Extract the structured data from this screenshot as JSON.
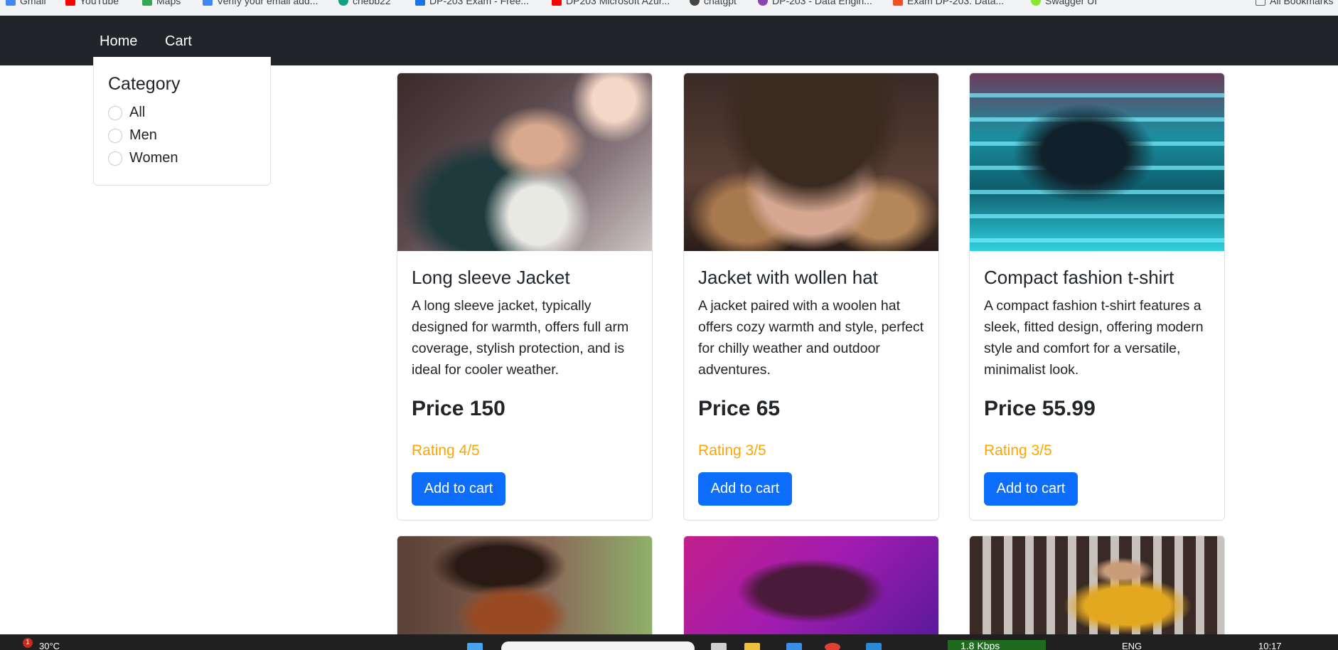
{
  "bookmarks": [
    {
      "label": "Gmail",
      "icon": "gmail-icon",
      "color": "#4285f4"
    },
    {
      "label": "YouTube",
      "icon": "youtube-icon",
      "color": "#ff0000"
    },
    {
      "label": "Maps",
      "icon": "maps-icon",
      "color": "#34a853"
    },
    {
      "label": "Verify your email add...",
      "icon": "google-icon",
      "color": "#4285f4"
    },
    {
      "label": "chebb22",
      "icon": "chatgpt-icon",
      "color": "#10a37f"
    },
    {
      "label": "DP-203 Exam - Free...",
      "icon": "doc-icon",
      "color": "#1a73e8"
    },
    {
      "label": "DP203 Microsoft Azur...",
      "icon": "youtube-icon",
      "color": "#ff0000"
    },
    {
      "label": "chatgpt",
      "icon": "openai-icon",
      "color": "#444444"
    },
    {
      "label": "DP-203 - Data Engin...",
      "icon": "circle-icon",
      "color": "#8e44ad"
    },
    {
      "label": "Exam DP-203: Data...",
      "icon": "microsoft-icon",
      "color": "#f25022"
    },
    {
      "label": "Swagger UI",
      "icon": "swagger-icon",
      "color": "#85ea2d"
    },
    {
      "label": "All Bookmarks",
      "icon": "folder-icon",
      "color": "#5f6368"
    }
  ],
  "nav": {
    "home": "Home",
    "cart": "Cart"
  },
  "filter": {
    "title": "Category",
    "options": [
      "All",
      "Men",
      "Women"
    ],
    "selected": null
  },
  "products": [
    {
      "title": "Long sleeve Jacket",
      "description": "A long sleeve jacket, typically designed for warmth, offers full arm coverage, stylish protection, and is ideal for cooler weather.",
      "price": "Price 150",
      "rating": "Rating 4/5",
      "button": "Add to cart",
      "image": "woman-denim-jacket-sunglasses-photo"
    },
    {
      "title": "Jacket with wollen hat",
      "description": "A jacket paired with a woolen hat offers cozy warmth and style, perfect for chilly weather and outdoor adventures.",
      "price": "Price 65",
      "rating": "Rating 3/5",
      "button": "Add to cart",
      "image": "woman-fur-hat-photo"
    },
    {
      "title": "Compact fashion t-shirt",
      "description": "A compact fashion t-shirt features a sleek, fitted design, offering modern style and comfort for a versatile, minimalist look.",
      "price": "Price 55.99",
      "rating": "Rating 3/5",
      "button": "Add to cart",
      "image": "neon-escalator-photo"
    },
    {
      "image": "woman-brown-top-photo"
    },
    {
      "image": "woman-purple-dress-photo"
    },
    {
      "image": "man-yellow-hoodie-photo"
    }
  ],
  "taskbar": {
    "temperature": "30°C",
    "notification_count": "1",
    "network_speed": "1.8 Kbps",
    "language": "ENG",
    "time": "10:17"
  },
  "colors": {
    "navbar": "#212529",
    "primary_button": "#0d6efd",
    "rating": "#ffa500"
  }
}
